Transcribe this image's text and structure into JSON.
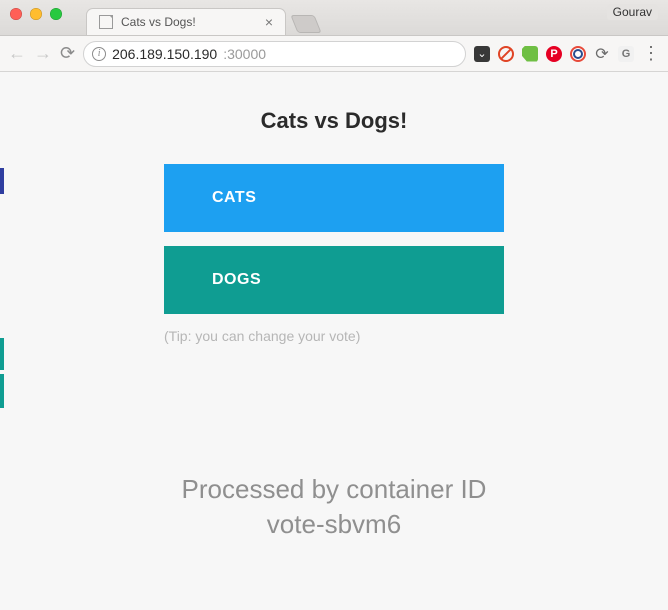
{
  "window": {
    "profile_name": "Gourav",
    "tab": {
      "title": "Cats vs Dogs!"
    }
  },
  "toolbar": {
    "url_host": "206.189.150.190",
    "url_port": ":30000"
  },
  "page": {
    "title": "Cats vs Dogs!",
    "vote_a": "CATS",
    "vote_b": "DOGS",
    "tip": "(Tip: you can change your vote)",
    "processed_line1": "Processed by container ID",
    "processed_line2": "vote-sbvm6"
  }
}
